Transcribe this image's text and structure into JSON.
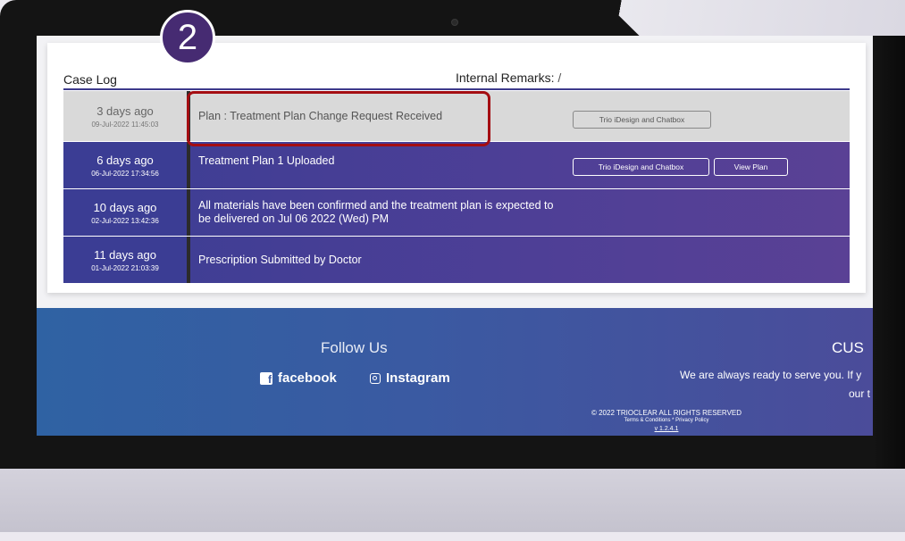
{
  "step_badge": "2",
  "case_log": {
    "title": "Case Log",
    "internal_remarks_label": "Internal Remarks:",
    "internal_remarks_value": "/",
    "rows": [
      {
        "ago": "3 days ago",
        "timestamp": "09-Jul-2022 11:45:03",
        "description": "Plan : Treatment Plan Change Request Received",
        "buttons": [
          "Trio iDesign and Chatbox"
        ]
      },
      {
        "ago": "6 days ago",
        "timestamp": "06-Jul-2022 17:34:56",
        "description": "Treatment Plan 1 Uploaded",
        "buttons": [
          "Trio iDesign and Chatbox",
          "View Plan"
        ]
      },
      {
        "ago": "10 days ago",
        "timestamp": "02-Jul-2022 13:42:36",
        "description_line1": "All materials have been confirmed and the treatment plan is expected to",
        "description_line2": "be delivered on Jul 06 2022 (Wed) PM"
      },
      {
        "ago": "11 days ago",
        "timestamp": "01-Jul-2022 21:03:39",
        "description": "Prescription Submitted by Doctor"
      }
    ]
  },
  "footer": {
    "follow_us": "Follow Us",
    "facebook": "facebook",
    "instagram": "Instagram",
    "customer_title": "CUS",
    "customer_text": "We are always ready to serve you. If y",
    "customer_text2": "our t",
    "copyright": "© 2022 TRIOCLEAR ALL RIGHTS RESERVED",
    "terms": "Terms & Conditions * Privacy Policy",
    "version": "v 1.2.4.1"
  },
  "colors": {
    "accent_purple": "#3b3d94",
    "highlight_red": "#a40d12",
    "badge_purple": "#462b72"
  }
}
